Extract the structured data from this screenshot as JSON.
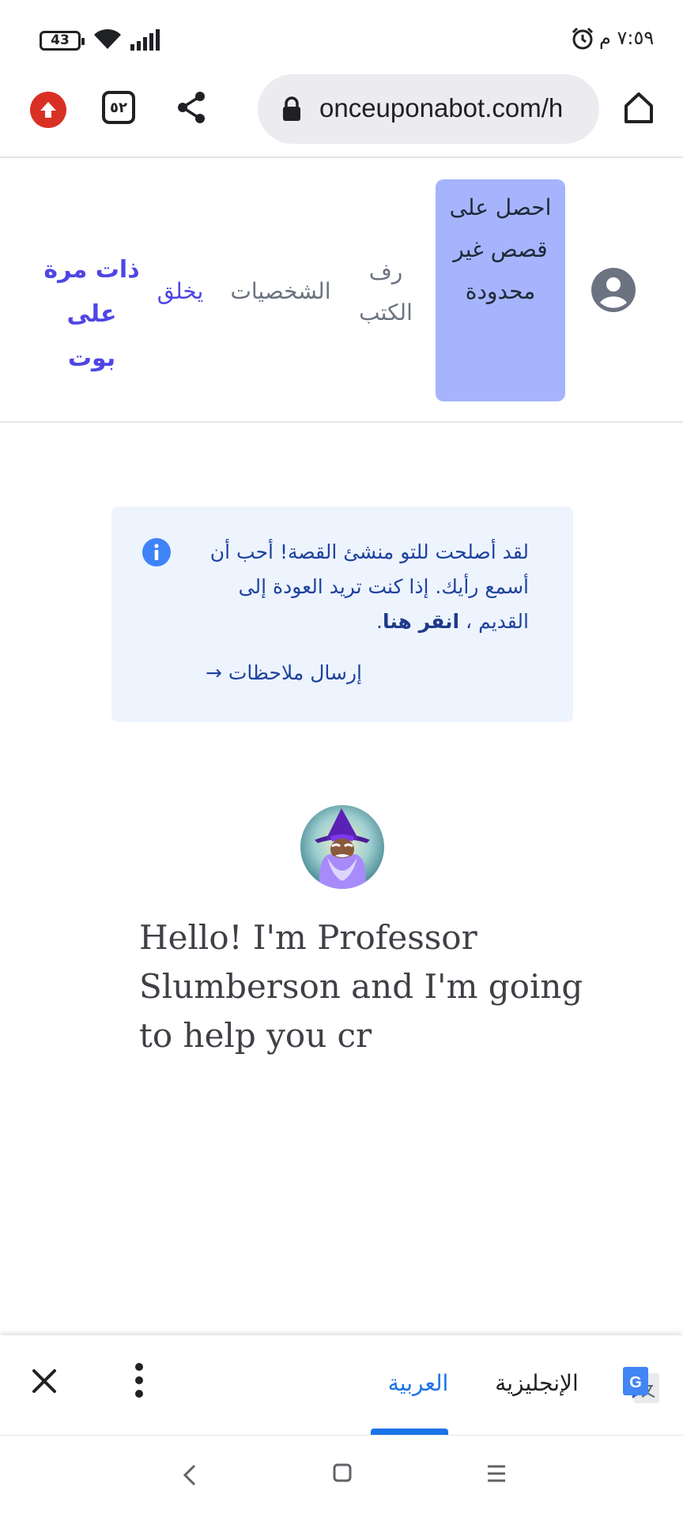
{
  "status_bar": {
    "time": "٧:٥٩ م",
    "battery": "43"
  },
  "browser": {
    "tabs_count": "٥٢",
    "url": "onceuponabot.com/h"
  },
  "site_nav": {
    "cta_label": "احصل على قصص غير محدودة",
    "bookshelf_label": "رف الكتب",
    "characters_label": "الشخصيات",
    "create_label": "يخلق",
    "brand_label": "ذات مرة على بوت"
  },
  "notice": {
    "text_main": "لقد أصلحت للتو منشئ القصة! أحب أن أسمع رأيك. إذا كنت تريد العودة إلى القديم ،",
    "link_label": "انقر هنا",
    "text_end": ".",
    "feedback_label": "إرسال ملاحظات →"
  },
  "greeting": "Hello! I'm Professor Slumberson and I'm going to help you cr",
  "translate_bar": {
    "lang_arabic": "العربية",
    "lang_english": "الإنجليزية"
  },
  "icons": {
    "update": "arrow-up-circle-icon",
    "share": "share-icon",
    "lock": "lock-icon",
    "home": "home-icon",
    "profile": "account-circle-icon",
    "info": "info-icon",
    "close": "close-icon",
    "more": "more-vert-icon",
    "google_translate": "google-translate-icon"
  },
  "colors": {
    "brand": "#4f46e5",
    "cta_bg": "#a5b4fc",
    "notice_bg": "#eef4fd",
    "notice_text": "#1e429f",
    "translate_accent": "#1a73e8",
    "update_badge": "#d93025"
  }
}
